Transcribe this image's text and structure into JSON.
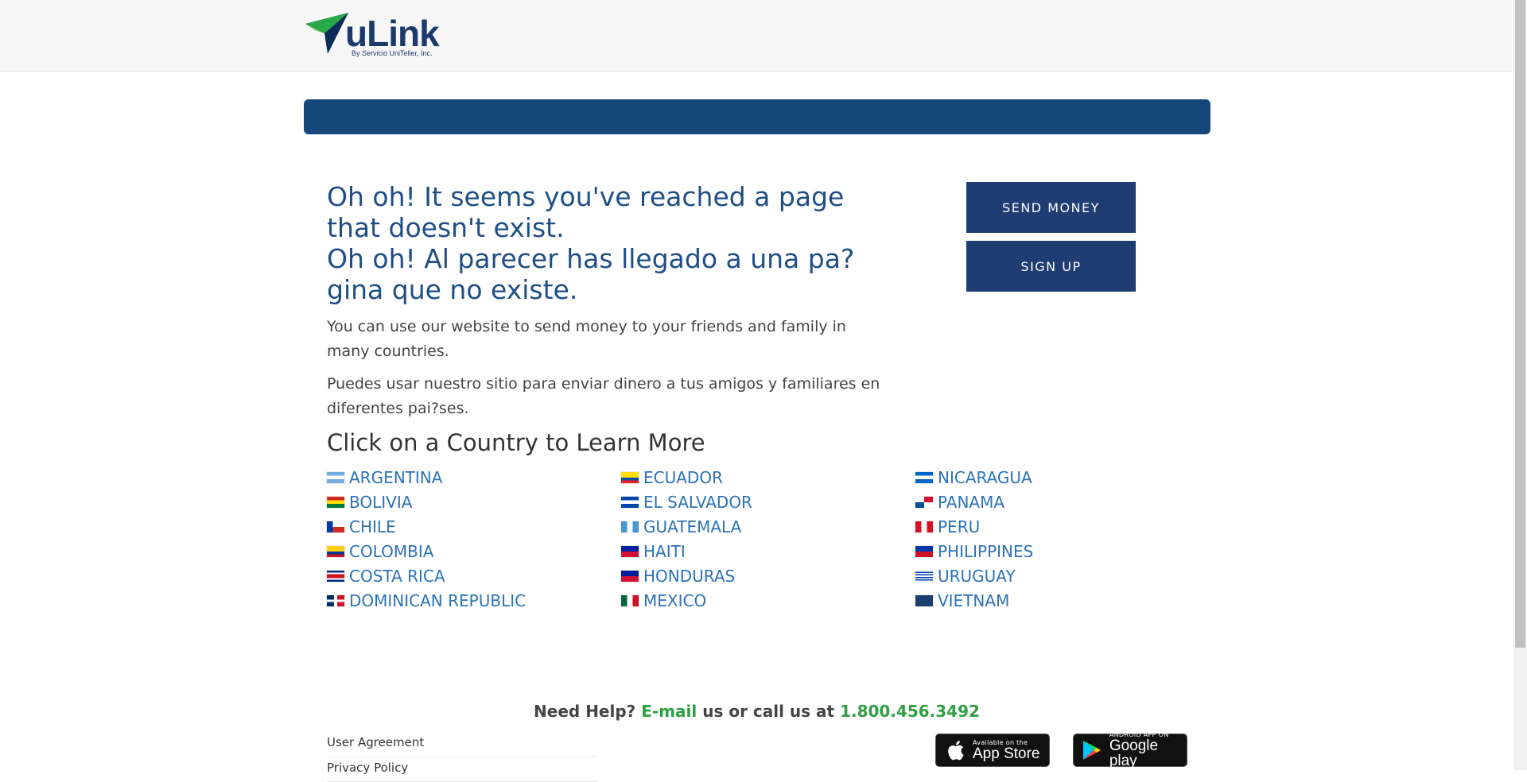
{
  "header": {
    "logo_text": "uLink",
    "logo_sub": "By Servicio UniTeller, Inc."
  },
  "main": {
    "headline_en": "Oh oh! It seems you've reached a page that doesn't exist.",
    "headline_es": "Oh oh! Al parecer has llegado a una pa?gina que no existe.",
    "para_en": "You can use our website to send money to your friends and family in many countries.",
    "para_es": "Puedes usar nuestro sitio para enviar dinero a tus amigos y familiares en diferentes pai?ses.",
    "countries_heading": "Click on a Country to Learn More",
    "countries": [
      {
        "name": "ARGENTINA",
        "flag": "flag-argentina-icon"
      },
      {
        "name": "BOLIVIA",
        "flag": "flag-bolivia-icon"
      },
      {
        "name": "CHILE",
        "flag": "flag-chile-icon"
      },
      {
        "name": "COLOMBIA",
        "flag": "flag-colombia-icon"
      },
      {
        "name": "COSTA RICA",
        "flag": "flag-costa-rica-icon"
      },
      {
        "name": "DOMINICAN REPUBLIC",
        "flag": "flag-dominican-republic-icon"
      },
      {
        "name": "ECUADOR",
        "flag": "flag-ecuador-icon"
      },
      {
        "name": "EL SALVADOR",
        "flag": "flag-el-salvador-icon"
      },
      {
        "name": "GUATEMALA",
        "flag": "flag-guatemala-icon"
      },
      {
        "name": "HAITI",
        "flag": "flag-haiti-icon"
      },
      {
        "name": "HONDURAS",
        "flag": "flag-honduras-icon"
      },
      {
        "name": "MEXICO",
        "flag": "flag-mexico-icon"
      },
      {
        "name": "NICARAGUA",
        "flag": "flag-nicaragua-icon"
      },
      {
        "name": "PANAMA",
        "flag": "flag-panama-icon"
      },
      {
        "name": "PERU",
        "flag": "flag-peru-icon"
      },
      {
        "name": "PHILIPPINES",
        "flag": "flag-philippines-icon"
      },
      {
        "name": "URUGUAY",
        "flag": "flag-uruguay-icon"
      },
      {
        "name": "VIETNAM",
        "flag": "flag-vietnam-icon"
      }
    ]
  },
  "sidebar": {
    "send_money": "SEND MONEY",
    "sign_up": "SIGN UP"
  },
  "footer": {
    "need_help": "Need Help?",
    "email": "E-mail",
    "call_text": "us or call us at",
    "phone": "1.800.456.3492",
    "links": [
      "User Agreement",
      "Privacy Policy"
    ],
    "app_store_small": "Available on the",
    "app_store_big": "App Store",
    "google_small": "ANDROID APP ON",
    "google_big": "Google play"
  },
  "colors": {
    "brand_blue": "#15477a",
    "button_blue": "#1f3c73",
    "link_blue": "#2b72b8",
    "heading_blue": "#1f4e86",
    "help_green": "#2ea043"
  }
}
